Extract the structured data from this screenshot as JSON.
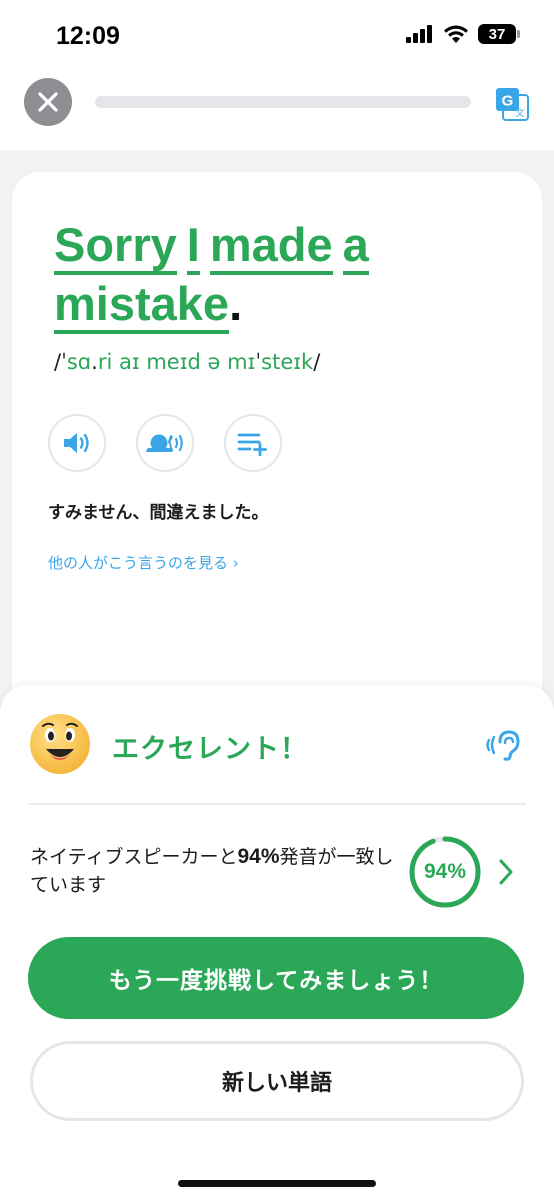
{
  "status_bar": {
    "time": "12:09",
    "battery": "37"
  },
  "nav": {
    "progress": 0.0
  },
  "phrase": {
    "words": [
      "Sorry",
      "I",
      "made",
      "a",
      "mistake"
    ],
    "end_punct": ".",
    "ipa_start": "/ˈ",
    "ipa_green1": "sɑ",
    "ipa_mid": ".",
    "ipa_green2": "ri aɪ meɪd ə mɪ",
    "ipa_tick": "ˈ",
    "ipa_green3": "steɪk",
    "ipa_end": "/"
  },
  "translation": "すみません、間違えました。",
  "see_others": "他の人がこう言うのを見る ›",
  "result": {
    "title": "エクセレント！",
    "score_prefix": "ネイティブスピーカーと",
    "score_value": "94%",
    "score_suffix": "発音が一致しています",
    "score_ring_label": "94%",
    "score_fraction": 0.94
  },
  "buttons": {
    "retry": "もう一度挑戦してみましょう！",
    "new_word": "新しい単語"
  },
  "colors": {
    "accent_green": "#2aa757",
    "link_blue": "#3aa6e8",
    "icon_blue": "#3aa6e8"
  }
}
